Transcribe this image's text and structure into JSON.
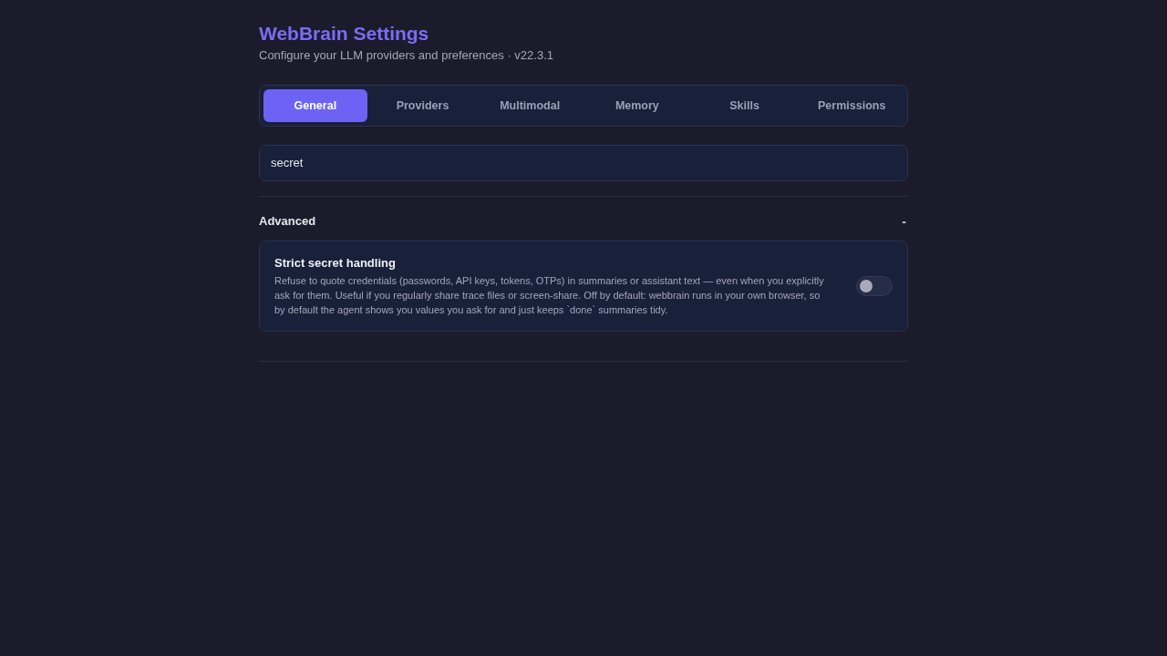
{
  "header": {
    "title": "WebBrain Settings",
    "subtitle": "Configure your LLM providers and preferences · v22.3.1"
  },
  "tabs": [
    {
      "label": "General",
      "selected": true
    },
    {
      "label": "Providers",
      "selected": false
    },
    {
      "label": "Multimodal",
      "selected": false
    },
    {
      "label": "Memory",
      "selected": false
    },
    {
      "label": "Skills",
      "selected": false
    },
    {
      "label": "Permissions",
      "selected": false
    }
  ],
  "search": {
    "value": "secret"
  },
  "section": {
    "title": "Advanced",
    "expanded": true,
    "toggle_glyph": "-",
    "settings": [
      {
        "title": "Strict secret handling",
        "description": "Refuse to quote credentials (passwords, API keys, tokens, OTPs) in summaries or assistant text — even when you explicitly ask for them. Useful if you regularly share trace files or screen-share. Off by default: webbrain runs in your own browser, so by default the agent shows you values you ask for and just keeps `done` summaries tidy.",
        "on": false
      }
    ]
  }
}
